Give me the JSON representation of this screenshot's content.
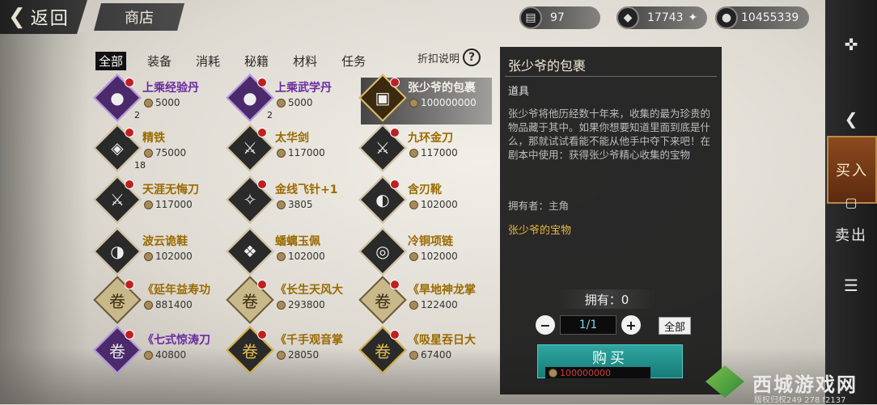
{
  "topbar": {
    "back_label": "返回",
    "shop_label": "商店"
  },
  "resources": [
    {
      "icon": "ticket-icon",
      "value": "97"
    },
    {
      "icon": "silver-icon",
      "value": "17743"
    },
    {
      "icon": "coin-icon",
      "value": "10455339"
    }
  ],
  "categories": [
    "全部",
    "装备",
    "消耗",
    "秘籍",
    "材料",
    "任务"
  ],
  "discount_label": "折扣说明",
  "items": [
    {
      "name": "上乘经验丹",
      "price": "5000",
      "qty": "2"
    },
    {
      "name": "上乘武学丹",
      "price": "5000",
      "qty": "2"
    },
    {
      "name": "张少爷的包裹",
      "price": "100000000",
      "qty": ""
    },
    {
      "name": "精铁",
      "price": "75000",
      "qty": "18"
    },
    {
      "name": "太华剑",
      "price": "117000",
      "qty": ""
    },
    {
      "name": "九环金刀",
      "price": "117000",
      "qty": ""
    },
    {
      "name": "天涯无悔刀",
      "price": "117000",
      "qty": ""
    },
    {
      "name": "金线飞针+1",
      "price": "3805",
      "qty": ""
    },
    {
      "name": "含刃靴",
      "price": "102000",
      "qty": ""
    },
    {
      "name": "波云诡鞋",
      "price": "102000",
      "qty": ""
    },
    {
      "name": "蟠螭玉佩",
      "price": "102000",
      "qty": ""
    },
    {
      "name": "冷铜项链",
      "price": "102000",
      "qty": ""
    },
    {
      "name": "《延年益寿功",
      "price": "881400",
      "qty": ""
    },
    {
      "name": "《长生天风大",
      "price": "293800",
      "qty": ""
    },
    {
      "name": "《旱地神龙掌",
      "price": "122400",
      "qty": ""
    },
    {
      "name": "《七式惊涛刀",
      "price": "40800",
      "qty": ""
    },
    {
      "name": "《千手观音掌",
      "price": "28050",
      "qty": ""
    },
    {
      "name": "《吸星吞日大",
      "price": "67400",
      "qty": ""
    }
  ],
  "detail": {
    "title": "张少爷的包裹",
    "type": "道具",
    "description": "张少爷将他历经数十年来，收集的最为珍贵的物品藏于其中。如果你想要知道里面到底是什么，那就试试看能不能从他手中夺下来吧！在剧本中使用：获得张少爷精心收集的宝物",
    "owner": "拥有者：主角",
    "tag": "张少爷的宝物",
    "own_label": "拥有：0",
    "quantity": "1/1",
    "all_label": "全部",
    "buy_label": "购买",
    "buy_price": "100000000"
  },
  "rail": {
    "buy_label": "买入",
    "sell_label": "卖出"
  },
  "watermark": {
    "text": "西城游戏网",
    "sub": "版权归权249 278 f2137"
  }
}
